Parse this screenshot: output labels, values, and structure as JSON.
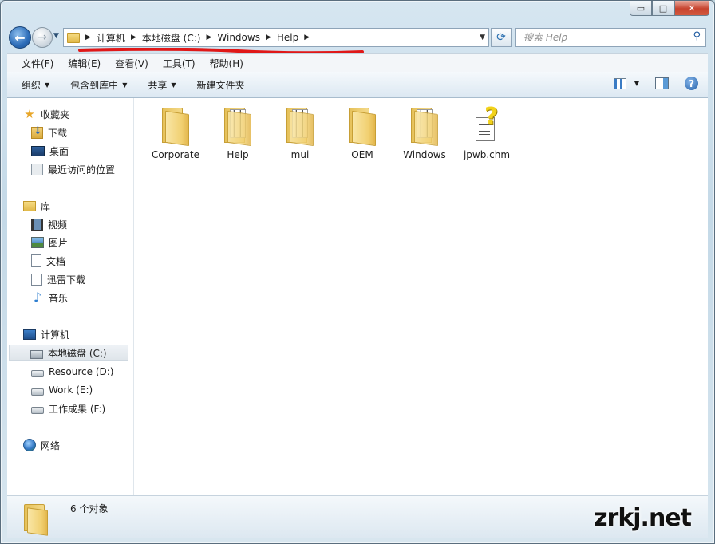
{
  "caption": {
    "minimize": "▭",
    "maximize": "□",
    "close": "✕"
  },
  "breadcrumbs": [
    "计算机",
    "本地磁盘 (C:)",
    "Windows",
    "Help"
  ],
  "search": {
    "placeholder": "搜索 Help"
  },
  "menu": [
    "文件(F)",
    "编辑(E)",
    "查看(V)",
    "工具(T)",
    "帮助(H)"
  ],
  "commands": [
    {
      "label": "组织",
      "dropdown": true
    },
    {
      "label": "包含到库中",
      "dropdown": true
    },
    {
      "label": "共享",
      "dropdown": true
    },
    {
      "label": "新建文件夹",
      "dropdown": false
    }
  ],
  "help_label": "?",
  "nav": {
    "favorites": {
      "label": "收藏夹",
      "items": [
        "下载",
        "桌面",
        "最近访问的位置"
      ]
    },
    "libraries": {
      "label": "库",
      "items": [
        "视频",
        "图片",
        "文档",
        "迅雷下载",
        "音乐"
      ]
    },
    "computer": {
      "label": "计算机",
      "items": [
        "本地磁盘 (C:)",
        "Resource (D:)",
        "Work (E:)",
        "工作成果 (F:)"
      ],
      "selected": "本地磁盘 (C:)"
    },
    "network": {
      "label": "网络"
    }
  },
  "files": [
    {
      "name": "Corporate",
      "type": "folder"
    },
    {
      "name": "Help",
      "type": "folder-docs"
    },
    {
      "name": "mui",
      "type": "folder-docs"
    },
    {
      "name": "OEM",
      "type": "folder"
    },
    {
      "name": "Windows",
      "type": "folder-docs"
    },
    {
      "name": "jpwb.chm",
      "type": "chm"
    }
  ],
  "status": {
    "text": "6 个对象"
  },
  "watermark": "zrkj.net",
  "colors": {
    "annotation_red": "#e01818",
    "accent": "#2c6cb8"
  }
}
